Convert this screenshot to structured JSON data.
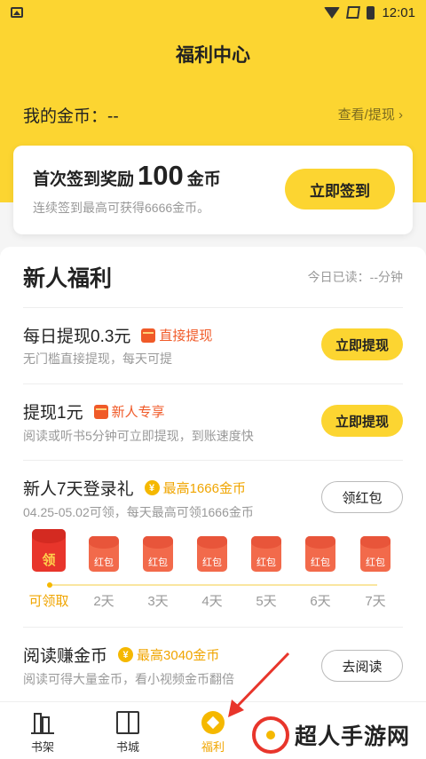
{
  "status_bar": {
    "time": "12:01"
  },
  "header": {
    "title": "福利中心",
    "coins_label": "我的金币：--",
    "coins_link": "查看/提现 ›"
  },
  "sign_card": {
    "title_prefix": "首次签到奖励",
    "title_amount": "100",
    "title_suffix": "金币",
    "subtitle": "连续签到最高可获得6666金币。",
    "button": "立即签到"
  },
  "newbie": {
    "title": "新人福利",
    "read_today": "今日已读：--分钟",
    "items": [
      {
        "title": "每日提现0.3元",
        "tag": "直接提现",
        "subtitle": "无门槛直接提现，每天可提",
        "button": "立即提现"
      },
      {
        "title": "提现1元",
        "tag": "新人专享",
        "subtitle": "阅读或听书5分钟可立即提现，到账速度快",
        "button": "立即提现"
      },
      {
        "title": "新人7天登录礼",
        "tag": "最高1666金币",
        "subtitle": "04.25-05.02可领，每天最高可领1666金币",
        "button": "领红包"
      },
      {
        "title": "阅读赚金币",
        "tag": "最高3040金币",
        "subtitle": "阅读可得大量金币，看小视频金币翻倍",
        "button": "去阅读"
      }
    ],
    "login_days": [
      {
        "env": "领",
        "label": "可领取"
      },
      {
        "env": "红包",
        "label": "2天"
      },
      {
        "env": "红包",
        "label": "3天"
      },
      {
        "env": "红包",
        "label": "4天"
      },
      {
        "env": "红包",
        "label": "5天"
      },
      {
        "env": "红包",
        "label": "6天"
      },
      {
        "env": "红包",
        "label": "7天"
      }
    ]
  },
  "tabbar": {
    "tabs": [
      "书架",
      "书城",
      "福利"
    ]
  },
  "watermark": {
    "text": "超人手游网"
  },
  "colors": {
    "brand": "#fcd531",
    "accent": "#f0a500",
    "red": "#e8352b"
  }
}
